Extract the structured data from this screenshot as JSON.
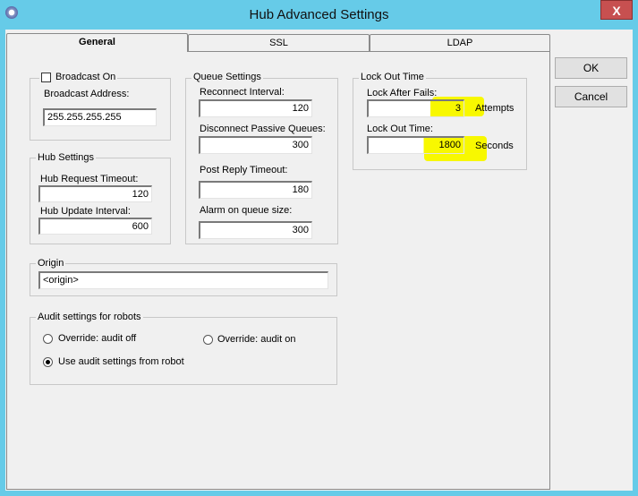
{
  "window": {
    "title": "Hub Advanced Settings",
    "close_label": "X"
  },
  "tabs": [
    {
      "label": "General"
    },
    {
      "label": "SSL"
    },
    {
      "label": "LDAP"
    }
  ],
  "buttons": {
    "ok": "OK",
    "cancel": "Cancel"
  },
  "broadcast": {
    "checkbox_label": "Broadcast On",
    "checked": false,
    "address_label": "Broadcast Address:",
    "address_value": "255.255.255.255"
  },
  "hub_settings": {
    "title": "Hub Settings",
    "request_timeout_label": "Hub Request Timeout:",
    "request_timeout_value": "120",
    "update_interval_label": "Hub Update Interval:",
    "update_interval_value": "600"
  },
  "queue_settings": {
    "title": "Queue Settings",
    "reconnect_label": "Reconnect Interval:",
    "reconnect_value": "120",
    "disconnect_label": "Disconnect Passive Queues:",
    "disconnect_value": "300",
    "post_reply_label": "Post Reply Timeout:",
    "post_reply_value": "180",
    "alarm_label": "Alarm on queue size:",
    "alarm_value": "300"
  },
  "lock_out": {
    "title": "Lock Out Time",
    "fails_label": "Lock After Fails:",
    "fails_value": "3",
    "fails_unit": "Attempts",
    "time_label": "Lock Out Time:",
    "time_value": "1800",
    "time_unit": "Seconds",
    "highlight_color": "#f8f800"
  },
  "origin": {
    "title": "Origin",
    "value": "<origin>"
  },
  "audit": {
    "title": "Audit settings for robots",
    "option_off": "Override: audit off",
    "option_on": "Override: audit on",
    "option_robot": "Use audit settings from robot",
    "selected": "option_robot"
  }
}
